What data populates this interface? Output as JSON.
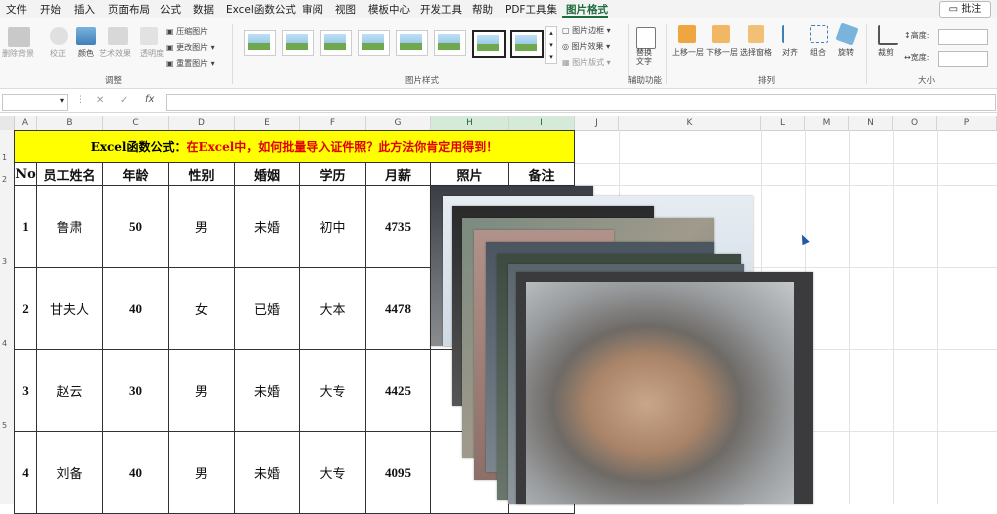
{
  "menu": [
    "文件",
    "开始",
    "插入",
    "页面布局",
    "公式",
    "数据",
    "Excel函数公式",
    "审阅",
    "视图",
    "模板中心",
    "开发工具",
    "帮助",
    "PDF工具集",
    "图片格式"
  ],
  "comment_button": "批注",
  "ribbon": {
    "adjust": {
      "remove_bg": "删除背景",
      "correct": "校正",
      "color": "颜色",
      "artistic": "艺术效果",
      "transparency": "透明度",
      "compress": "压缩图片",
      "change": "更改图片",
      "reset": "重置图片",
      "group": "调整"
    },
    "styles": {
      "group": "图片样式",
      "border": "图片边框",
      "effects": "图片效果",
      "layout": "图片版式"
    },
    "accessibility": {
      "alt_text": "替换文字",
      "group": "辅助功能"
    },
    "arrange": {
      "forward": "上移一层",
      "backward": "下移一层",
      "selection_pane": "选择窗格",
      "align": "对齐",
      "group_btn": "组合",
      "rotate": "旋转",
      "group": "排列"
    },
    "size": {
      "crop": "裁剪",
      "height": "高度:",
      "width": "宽度:",
      "group": "大小"
    }
  },
  "formula": {
    "fx": "fx",
    "x": "✕",
    "check": "✓"
  },
  "columns": [
    "A",
    "B",
    "C",
    "D",
    "E",
    "F",
    "G",
    "H",
    "I",
    "J",
    "K",
    "L",
    "M",
    "N",
    "O",
    "P"
  ],
  "rows": [
    "1",
    "2",
    "3",
    "4",
    "5"
  ],
  "sheet": {
    "title_black": "Excel函数公式：",
    "title_red": "在Excel中，如何批量导入证件照？此方法你肯定用得到！",
    "headers": [
      "No",
      "员工姓名",
      "年龄",
      "性别",
      "婚姻",
      "学历",
      "月薪",
      "照片",
      "备注"
    ],
    "data": [
      [
        "1",
        "鲁肃",
        "50",
        "男",
        "未婚",
        "初中",
        "4735"
      ],
      [
        "2",
        "甘夫人",
        "40",
        "女",
        "已婚",
        "大本",
        "4478"
      ],
      [
        "3",
        "赵云",
        "30",
        "男",
        "未婚",
        "大专",
        "4425"
      ],
      [
        "4",
        "刘备",
        "40",
        "男",
        "未婚",
        "大专",
        "4095"
      ]
    ]
  },
  "colors": {
    "accent": "#1e6b3c",
    "title_bg": "#ffff00",
    "title_red": "#e00000"
  }
}
